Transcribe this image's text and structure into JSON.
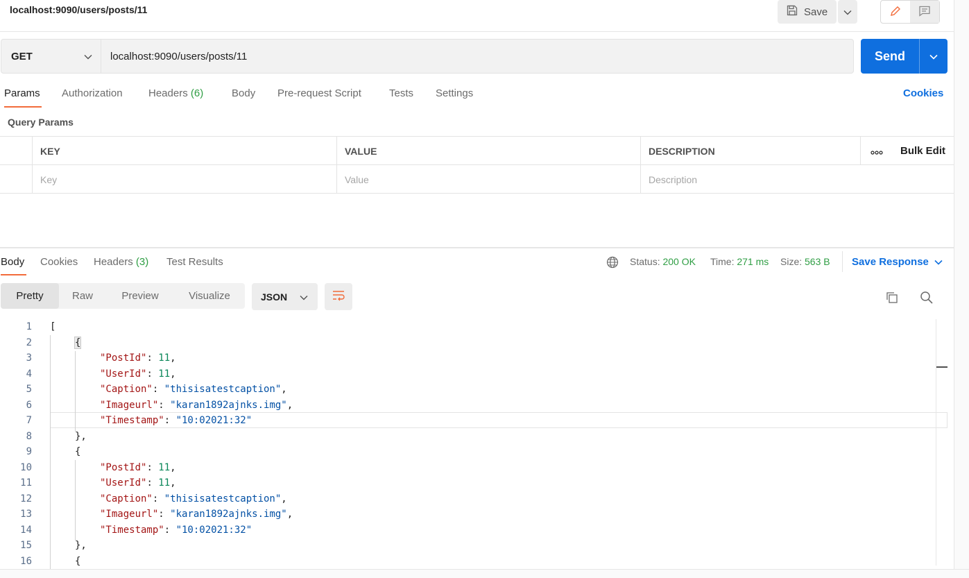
{
  "title": "localhost:9090/users/posts/11",
  "toolbar": {
    "save_label": "Save"
  },
  "request": {
    "method": "GET",
    "url": "localhost:9090/users/posts/11",
    "send_label": "Send"
  },
  "request_tabs": {
    "params": "Params",
    "authorization": "Authorization",
    "headers": "Headers",
    "headers_count": "(6)",
    "body": "Body",
    "prerequest": "Pre-request Script",
    "tests": "Tests",
    "settings": "Settings",
    "cookies": "Cookies"
  },
  "query_params": {
    "title": "Query Params",
    "columns": {
      "key": "KEY",
      "value": "VALUE",
      "description": "DESCRIPTION",
      "bulk_edit": "Bulk Edit"
    },
    "placeholders": {
      "key": "Key",
      "value": "Value",
      "description": "Description"
    }
  },
  "response_tabs": {
    "body": "Body",
    "cookies": "Cookies",
    "headers": "Headers",
    "headers_count": "(3)",
    "test_results": "Test Results"
  },
  "response_status": {
    "status_label": "Status:",
    "status_value": "200 OK",
    "time_label": "Time:",
    "time_value": "271 ms",
    "size_label": "Size:",
    "size_value": "563 B",
    "save_response": "Save Response"
  },
  "view_modes": {
    "pretty": "Pretty",
    "raw": "Raw",
    "preview": "Preview",
    "visualize": "Visualize"
  },
  "format": "JSON",
  "colors": {
    "accent": "#0f6fdf",
    "tab_underline": "#f26b3a",
    "status_ok": "#2f9e44"
  },
  "icons": [
    "floppy-disk-icon",
    "chevron-down-icon",
    "pencil-icon",
    "comment-icon",
    "globe-icon",
    "copy-icon",
    "search-icon",
    "wrap-lines-icon",
    "more-horizontal-icon"
  ],
  "code": {
    "line_numbers": [
      "1",
      "2",
      "3",
      "4",
      "5",
      "6",
      "7",
      "8",
      "9",
      "10",
      "11",
      "12",
      "13",
      "14",
      "15",
      "16"
    ],
    "open_array": "[",
    "open_obj": "{",
    "close_obj": "},",
    "colon": ": ",
    "comma": ",",
    "records": [
      {
        "postid_key": "\"PostId\"",
        "postid_val": "11",
        "userid_key": "\"UserId\"",
        "userid_val": "11",
        "caption_key": "\"Caption\"",
        "caption_val": "\"thisisatestcaption\"",
        "image_key": "\"Imageurl\"",
        "image_val": "\"karan1892ajnks.img\"",
        "ts_key": "\"Timestamp\"",
        "ts_val": "\"10:02021:32\""
      },
      {
        "postid_key": "\"PostId\"",
        "postid_val": "11",
        "userid_key": "\"UserId\"",
        "userid_val": "11",
        "caption_key": "\"Caption\"",
        "caption_val": "\"thisisatestcaption\"",
        "image_key": "\"Imageurl\"",
        "image_val": "\"karan1892ajnks.img\"",
        "ts_key": "\"Timestamp\"",
        "ts_val": "\"10:02021:32\""
      }
    ]
  }
}
